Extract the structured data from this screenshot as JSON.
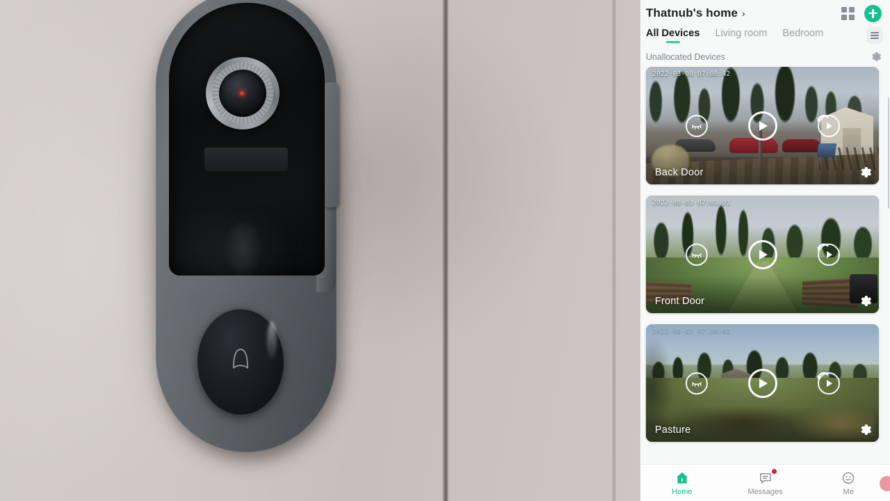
{
  "app": {
    "header": {
      "home_name": "Thatnub's home",
      "chevron": "›",
      "grid_icon": "grid-view-icon",
      "add_icon": "plus-icon"
    },
    "tabs": [
      {
        "label": "All Devices",
        "active": true
      },
      {
        "label": "Living room",
        "active": false
      },
      {
        "label": "Bedroom",
        "active": false
      }
    ],
    "tab_menu_icon": "hamburger-menu-icon",
    "section": {
      "label": "Unallocated Devices",
      "settings_icon": "gear-icon"
    },
    "devices": [
      {
        "name": "Back Door",
        "timestamp": "2022-03-08 07:00:42",
        "timestamp_faded": false,
        "controls": [
          "privacy-eye-off-icon",
          "play-icon",
          "replay-icon"
        ],
        "settings_icon": "gear-icon"
      },
      {
        "name": "Front Door",
        "timestamp": "2022-08-03 07:08:03",
        "timestamp_faded": false,
        "controls": [
          "privacy-eye-off-icon",
          "play-icon",
          "replay-icon"
        ],
        "settings_icon": "gear-icon"
      },
      {
        "name": "Pasture",
        "timestamp": "2022-08-03 07:08:03",
        "timestamp_faded": true,
        "controls": [
          "privacy-eye-off-icon",
          "play-icon",
          "replay-icon"
        ],
        "settings_icon": "gear-icon"
      }
    ],
    "bottom_nav": [
      {
        "label": "Home",
        "icon": "home-icon",
        "active": true,
        "badge": false
      },
      {
        "label": "Messages",
        "icon": "message-icon",
        "active": false,
        "badge": true
      },
      {
        "label": "Me",
        "icon": "profile-smiley-icon",
        "active": false,
        "badge": false
      }
    ]
  },
  "video": {
    "subject": "video-doorbell-on-wall",
    "doorbell_button_icon": "bell-icon",
    "lens_icon": "camera-lens"
  },
  "colors": {
    "accent_green": "#15c28e",
    "tab_underline": "#2bd49a",
    "badge_red": "#e02020",
    "app_background": "#f7f8f8",
    "title_text": "#1d1f20",
    "muted_text": "#8b9195"
  }
}
